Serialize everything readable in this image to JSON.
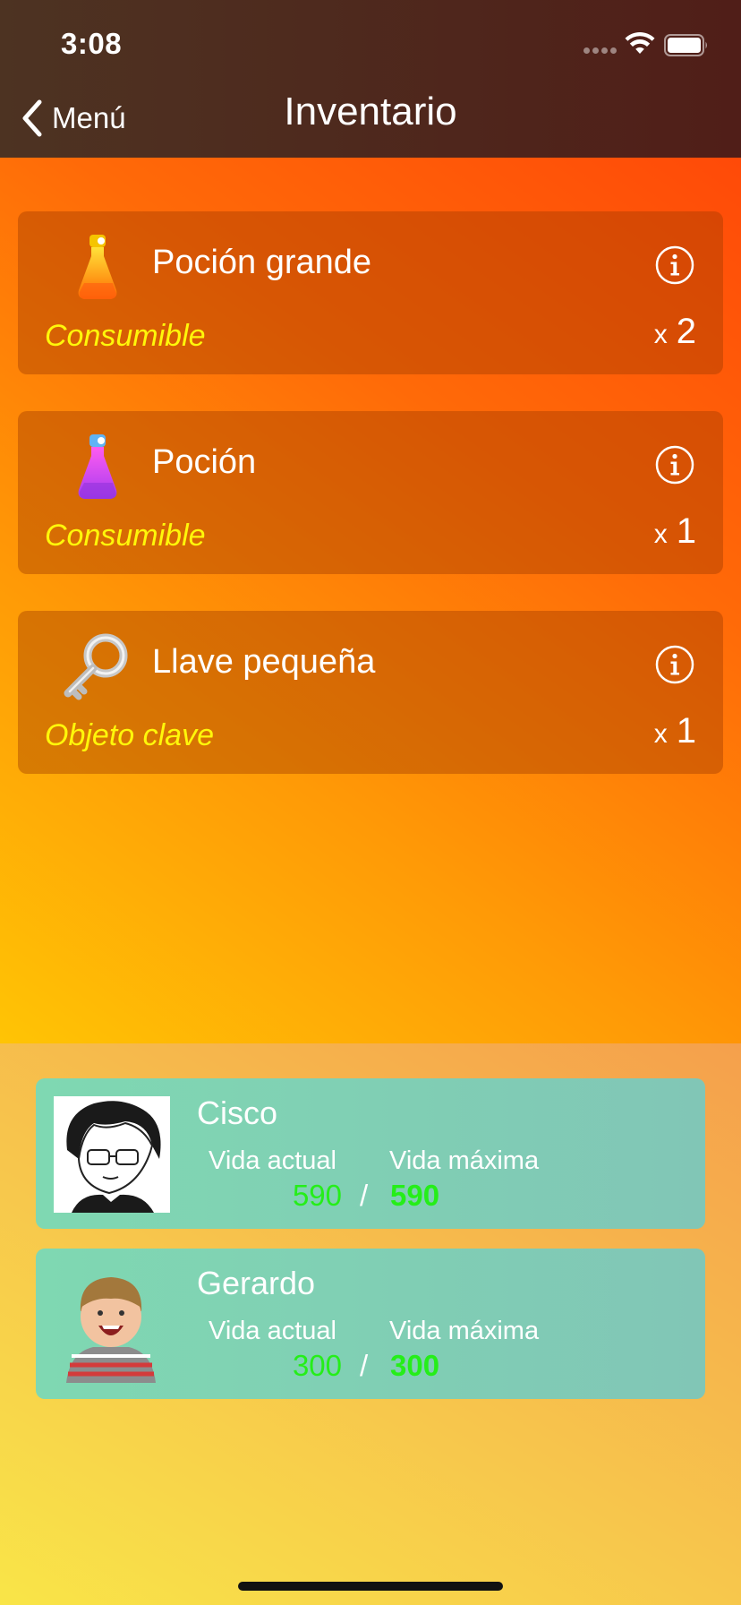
{
  "status_bar": {
    "time": "3:08"
  },
  "nav": {
    "back_label": "Menú",
    "title": "Inventario"
  },
  "inventory": [
    {
      "name": "Poción grande",
      "category": "Consumible",
      "qty_prefix": "x",
      "qty": "2",
      "icon": "large-potion-icon"
    },
    {
      "name": "Poción",
      "category": "Consumible",
      "qty_prefix": "x",
      "qty": "1",
      "icon": "potion-icon"
    },
    {
      "name": "Llave pequeña",
      "category": "Objeto clave",
      "qty_prefix": "x",
      "qty": "1",
      "icon": "small-key-icon"
    }
  ],
  "party": [
    {
      "name": "Cisco",
      "current_label": "Vida actual",
      "max_label": "Vida máxima",
      "current_hp": "590",
      "separator": "/",
      "max_hp": "590"
    },
    {
      "name": "Gerardo",
      "current_label": "Vida actual",
      "max_label": "Vida máxima",
      "current_hp": "300",
      "separator": "/",
      "max_hp": "300"
    }
  ],
  "colors": {
    "nav_bg": "#4d3322",
    "category_text": "#fff70a",
    "hp_text": "#25ee19",
    "party_card": "#7fd8b2"
  }
}
